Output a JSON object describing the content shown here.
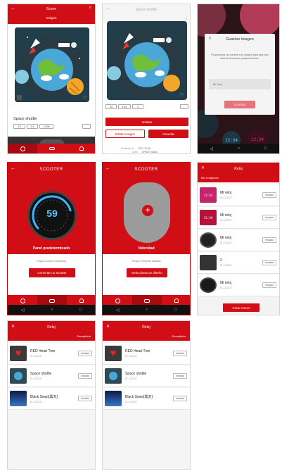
{
  "colors": {
    "brand_red": "#d10e16",
    "dark": "#1e1e1e"
  },
  "s1": {
    "title": "Scene",
    "tab": "Imágen",
    "card_title": "Space shuttle",
    "pills": [
      "4.0",
      "3.4",
      "4,008"
    ]
  },
  "s2": {
    "title": "Space shuttle",
    "pills": [
      "34",
      "4,46",
      "3"
    ],
    "install": "Instalar",
    "edit": "Editar imagen",
    "save": "Guardar",
    "meta_k1": "Publicado el",
    "meta_v1": "2017-12-08",
    "meta_k2": "Autor",
    "meta_v2": "SPACE Studio"
  },
  "s3": {
    "dialog_title": "Guardar imagen",
    "dialog_text": "Proporciona un nombre a la imagen para que sea fácil de encontrar posteriormente.",
    "placeholder": "Mi reloj",
    "button": "Guardar",
    "clock_left": "12:34",
    "clock_right": "12:34"
  },
  "s4": {
    "title": "SCOOTER",
    "gauge_value": "59",
    "subtitle": "Panel predeterminado",
    "status": "Ningún scooter conectado",
    "button": "Conectar un scooter"
  },
  "s5": {
    "title": "SCOOTER",
    "subtitle": "Velocidad",
    "status": "Ningún elemento añadido",
    "button": "Selecciona un diseño"
  },
  "s6": {
    "title": "Reloj",
    "section": "Mis imágenes",
    "action": "Instalar",
    "cta": "Crear nuevo",
    "items": [
      {
        "name": "Mi reloj",
        "date": "01.12.2017",
        "face": "12:54"
      },
      {
        "name": "Mi reloj",
        "date": "01.12.2017",
        "face": "12:39"
      },
      {
        "name": "Mi reloj",
        "date": "01.12.2017",
        "face": ""
      },
      {
        "name": "2",
        "date": "01.12.2017",
        "face": ""
      },
      {
        "name": "Mi reloj",
        "date": "01.12.2017",
        "face": ""
      }
    ]
  },
  "s7": {
    "title": "Reloj",
    "section": "Recopilado",
    "action": "Instalar",
    "items": [
      {
        "name": "RED Heart Tree",
        "date": "01.12.2017"
      },
      {
        "name": "Space shuttle",
        "date": "01.12.2017"
      },
      {
        "name": "Black Swan[黑天]",
        "date": "01.12.2017"
      }
    ]
  },
  "s8": {
    "title": "Reloj",
    "section": "Recopilado",
    "action": "Instalar",
    "items": [
      {
        "name": "RED Heart Tree",
        "date": "01.12.2017"
      },
      {
        "name": "Space shuttle",
        "date": "01.12.2017"
      },
      {
        "name": "Black Swan[黑天]",
        "date": "01.12.2017"
      }
    ]
  }
}
